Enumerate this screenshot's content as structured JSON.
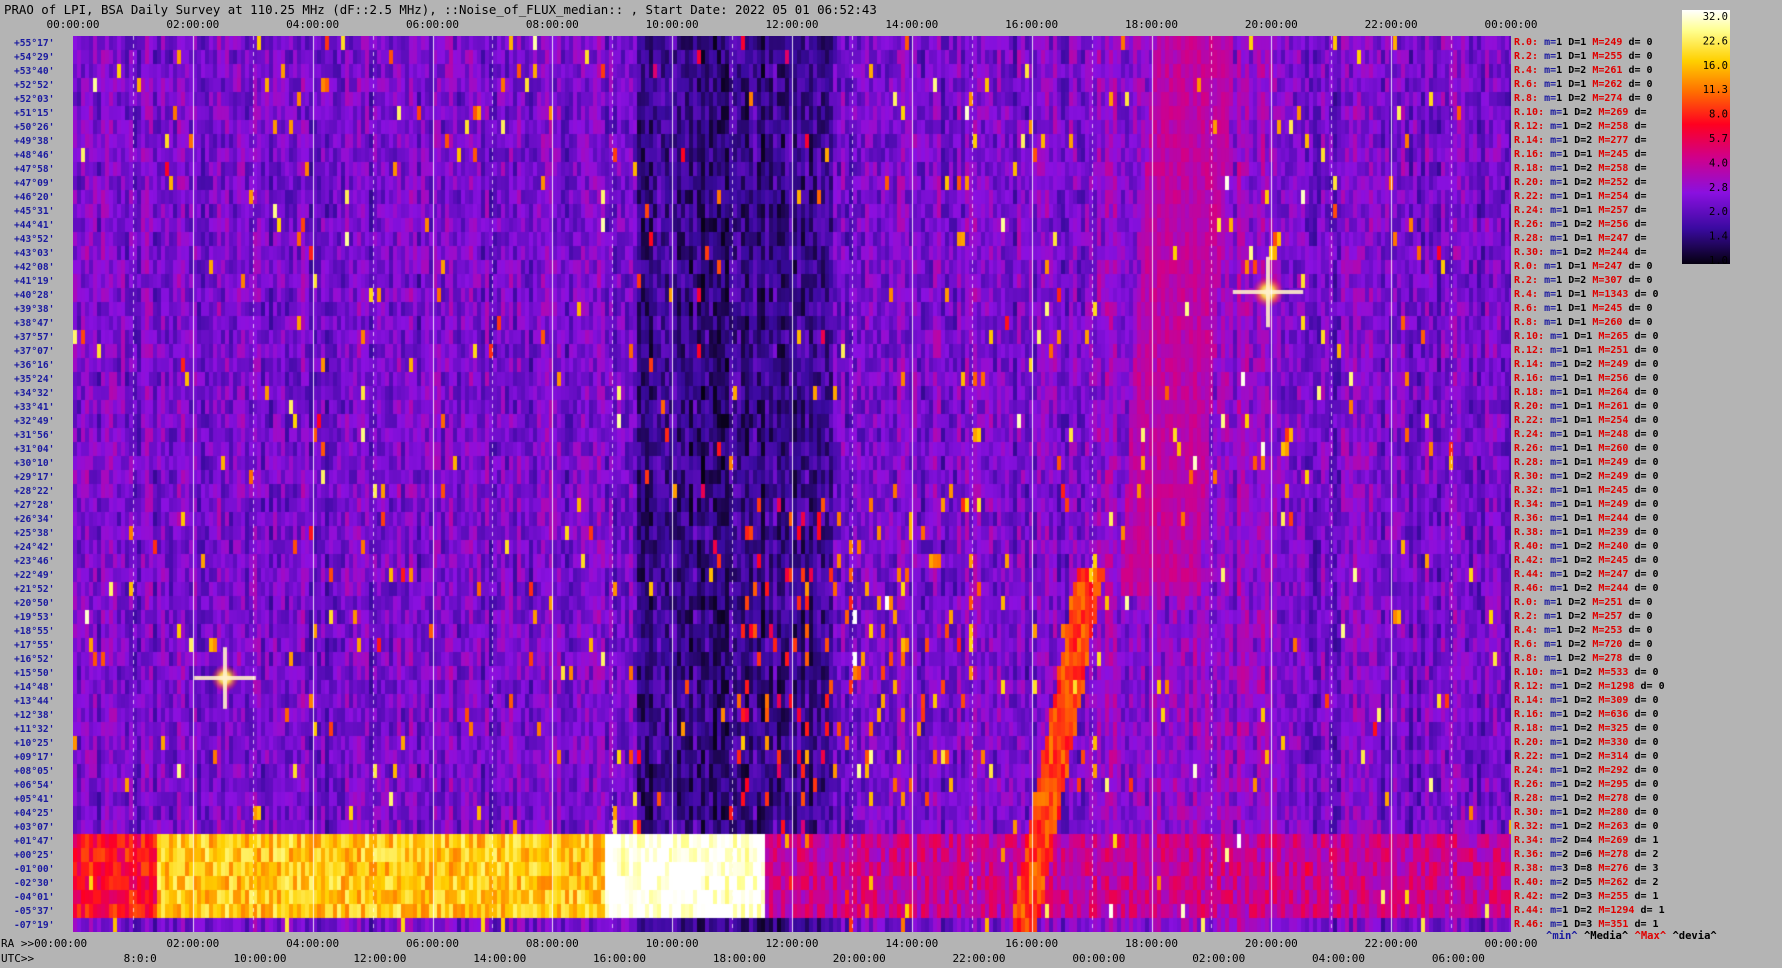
{
  "header": {
    "title": "PRAO of LPI, BSA Daily Survey at 110.25 MHz (dF::2.5 MHz), ::Noise_of_FLUX_median:: , Start Date: 2022 05 01 06:52:43"
  },
  "chart_data": {
    "type": "heatmap",
    "title": "PRAO of LPI, BSA Daily Survey at 110.25 MHz (dF::2.5 MHz), ::Noise_of_FLUX_median:: , Start Date: 2022 05 01 06:52:43",
    "top_axis_ticks": [
      "00:00:00",
      "02:00:00",
      "04:00:00",
      "06:00:00",
      "08:00:00",
      "10:00:00",
      "12:00:00",
      "14:00:00",
      "16:00:00",
      "18:00:00",
      "20:00:00",
      "22:00:00",
      "00:00:00"
    ],
    "ra_axis_label": "RA >>00:00:00",
    "ra_axis_ticks": [
      "02:00:00",
      "04:00:00",
      "06:00:00",
      "08:00:00",
      "10:00:00",
      "12:00:00",
      "14:00:00",
      "16:00:00",
      "18:00:00",
      "20:00:00",
      "22:00:00",
      "00:00:00"
    ],
    "utc_axis_label": "UTC>>",
    "utc_axis_ticks": [
      "8:0:0",
      "10:00:00",
      "12:00:00",
      "14:00:00",
      "16:00:00",
      "18:00:00",
      "20:00:00",
      "22:00:00",
      "00:00:00",
      "02:00:00",
      "04:00:00",
      "06:00:00"
    ],
    "declinations": [
      "+55°17'",
      "+54°29'",
      "+53°40'",
      "+52°52'",
      "+52°03'",
      "+51°15'",
      "+50°26'",
      "+49°38'",
      "+48°46'",
      "+47°58'",
      "+47°09'",
      "+46°20'",
      "+45°31'",
      "+44°41'",
      "+43°52'",
      "+43°03'",
      "+42°08'",
      "+41°19'",
      "+40°28'",
      "+39°38'",
      "+38°47'",
      "+37°57'",
      "+37°07'",
      "+36°16'",
      "+35°24'",
      "+34°32'",
      "+33°41'",
      "+32°49'",
      "+31°56'",
      "+31°04'",
      "+30°10'",
      "+29°17'",
      "+28°22'",
      "+27°28'",
      "+26°34'",
      "+25°38'",
      "+24°42'",
      "+23°46'",
      "+22°49'",
      "+21°52'",
      "+20°50'",
      "+19°53'",
      "+18°55'",
      "+17°55'",
      "+16°52'",
      "+15°50'",
      "+14°48'",
      "+13°44'",
      "+12°38'",
      "+11°32'",
      "+10°25'",
      "+09°17'",
      "+08°05'",
      "+06°54'",
      "+05°41'",
      "+04°25'",
      "+03°07'",
      "+01°47'",
      "+00°25'",
      "-01°00'",
      "-02°30'",
      "-04°01'",
      "-05°37'",
      "-07°19'"
    ],
    "colorbar": {
      "values": [
        "32.0",
        "22.6",
        "16.0",
        "11.3",
        "8.0",
        "5.7",
        "4.0",
        "2.8",
        "2.0",
        "1.4",
        "1.0"
      ],
      "scale": "log",
      "range": [
        1.0,
        32.0
      ]
    },
    "features": [
      {
        "kind": "point-source",
        "time": "02:42",
        "declination": "+15°50'"
      },
      {
        "kind": "point-source",
        "time": "20:00",
        "declination": "+40°28'"
      },
      {
        "kind": "bright-band",
        "declination": "-01°00'"
      }
    ]
  },
  "rows": [
    {
      "r": "R.0:",
      "m": "1",
      "D": "1",
      "M": "249",
      "d": "0"
    },
    {
      "r": "R.2:",
      "m": "1",
      "D": "1",
      "M": "255",
      "d": "0"
    },
    {
      "r": "R.4:",
      "m": "1",
      "D": "2",
      "M": "261",
      "d": "0"
    },
    {
      "r": "R.6:",
      "m": "1",
      "D": "1",
      "M": "262",
      "d": "0"
    },
    {
      "r": "R.8:",
      "m": "1",
      "D": "2",
      "M": "274",
      "d": "0"
    },
    {
      "r": "R.10:",
      "m": "1",
      "D": "2",
      "M": "269",
      "d": ""
    },
    {
      "r": "R.12:",
      "m": "1",
      "D": "2",
      "M": "258",
      "d": ""
    },
    {
      "r": "R.14:",
      "m": "1",
      "D": "2",
      "M": "277",
      "d": ""
    },
    {
      "r": "R.16:",
      "m": "1",
      "D": "1",
      "M": "245",
      "d": ""
    },
    {
      "r": "R.18:",
      "m": "1",
      "D": "2",
      "M": "258",
      "d": ""
    },
    {
      "r": "R.20:",
      "m": "1",
      "D": "2",
      "M": "252",
      "d": ""
    },
    {
      "r": "R.22:",
      "m": "1",
      "D": "1",
      "M": "254",
      "d": ""
    },
    {
      "r": "R.24:",
      "m": "1",
      "D": "1",
      "M": "257",
      "d": ""
    },
    {
      "r": "R.26:",
      "m": "1",
      "D": "2",
      "M": "256",
      "d": ""
    },
    {
      "r": "R.28:",
      "m": "1",
      "D": "1",
      "M": "247",
      "d": ""
    },
    {
      "r": "R.30:",
      "m": "1",
      "D": "2",
      "M": "244",
      "d": ""
    },
    {
      "r": "R.0:",
      "m": "1",
      "D": "1",
      "M": "247",
      "d": "0"
    },
    {
      "r": "R.2:",
      "m": "1",
      "D": "2",
      "M": "307",
      "d": "0"
    },
    {
      "r": "R.4:",
      "m": "1",
      "D": "1",
      "M": "1343",
      "d": "0"
    },
    {
      "r": "R.6:",
      "m": "1",
      "D": "1",
      "M": "245",
      "d": "0"
    },
    {
      "r": "R.8:",
      "m": "1",
      "D": "1",
      "M": "260",
      "d": "0"
    },
    {
      "r": "R.10:",
      "m": "1",
      "D": "1",
      "M": "265",
      "d": "0"
    },
    {
      "r": "R.12:",
      "m": "1",
      "D": "1",
      "M": "251",
      "d": "0"
    },
    {
      "r": "R.14:",
      "m": "1",
      "D": "2",
      "M": "249",
      "d": "0"
    },
    {
      "r": "R.16:",
      "m": "1",
      "D": "1",
      "M": "256",
      "d": "0"
    },
    {
      "r": "R.18:",
      "m": "1",
      "D": "1",
      "M": "264",
      "d": "0"
    },
    {
      "r": "R.20:",
      "m": "1",
      "D": "1",
      "M": "261",
      "d": "0"
    },
    {
      "r": "R.22:",
      "m": "1",
      "D": "1",
      "M": "254",
      "d": "0"
    },
    {
      "r": "R.24:",
      "m": "1",
      "D": "1",
      "M": "248",
      "d": "0"
    },
    {
      "r": "R.26:",
      "m": "1",
      "D": "1",
      "M": "260",
      "d": "0"
    },
    {
      "r": "R.28:",
      "m": "1",
      "D": "1",
      "M": "249",
      "d": "0"
    },
    {
      "r": "R.30:",
      "m": "1",
      "D": "2",
      "M": "249",
      "d": "0"
    },
    {
      "r": "R.32:",
      "m": "1",
      "D": "1",
      "M": "245",
      "d": "0"
    },
    {
      "r": "R.34:",
      "m": "1",
      "D": "1",
      "M": "249",
      "d": "0"
    },
    {
      "r": "R.36:",
      "m": "1",
      "D": "1",
      "M": "244",
      "d": "0"
    },
    {
      "r": "R.38:",
      "m": "1",
      "D": "1",
      "M": "239",
      "d": "0"
    },
    {
      "r": "R.40:",
      "m": "1",
      "D": "2",
      "M": "240",
      "d": "0"
    },
    {
      "r": "R.42:",
      "m": "1",
      "D": "2",
      "M": "245",
      "d": "0"
    },
    {
      "r": "R.44:",
      "m": "1",
      "D": "2",
      "M": "247",
      "d": "0"
    },
    {
      "r": "R.46:",
      "m": "1",
      "D": "2",
      "M": "244",
      "d": "0"
    },
    {
      "r": "R.0:",
      "m": "1",
      "D": "2",
      "M": "251",
      "d": "0"
    },
    {
      "r": "R.2:",
      "m": "1",
      "D": "2",
      "M": "257",
      "d": "0"
    },
    {
      "r": "R.4:",
      "m": "1",
      "D": "2",
      "M": "253",
      "d": "0"
    },
    {
      "r": "R.6:",
      "m": "1",
      "D": "2",
      "M": "720",
      "d": "0"
    },
    {
      "r": "R.8:",
      "m": "1",
      "D": "2",
      "M": "278",
      "d": "0"
    },
    {
      "r": "R.10:",
      "m": "1",
      "D": "2",
      "M": "533",
      "d": "0"
    },
    {
      "r": "R.12:",
      "m": "1",
      "D": "2",
      "M": "1298",
      "d": "0"
    },
    {
      "r": "R.14:",
      "m": "1",
      "D": "2",
      "M": "309",
      "d": "0"
    },
    {
      "r": "R.16:",
      "m": "1",
      "D": "2",
      "M": "636",
      "d": "0"
    },
    {
      "r": "R.18:",
      "m": "1",
      "D": "2",
      "M": "325",
      "d": "0"
    },
    {
      "r": "R.20:",
      "m": "1",
      "D": "2",
      "M": "330",
      "d": "0"
    },
    {
      "r": "R.22:",
      "m": "1",
      "D": "2",
      "M": "314",
      "d": "0"
    },
    {
      "r": "R.24:",
      "m": "1",
      "D": "2",
      "M": "292",
      "d": "0"
    },
    {
      "r": "R.26:",
      "m": "1",
      "D": "2",
      "M": "295",
      "d": "0"
    },
    {
      "r": "R.28:",
      "m": "1",
      "D": "2",
      "M": "278",
      "d": "0"
    },
    {
      "r": "R.30:",
      "m": "1",
      "D": "2",
      "M": "280",
      "d": "0"
    },
    {
      "r": "R.32:",
      "m": "1",
      "D": "2",
      "M": "263",
      "d": "0"
    },
    {
      "r": "R.34:",
      "m": "2",
      "D": "4",
      "M": "269",
      "d": "1"
    },
    {
      "r": "R.36:",
      "m": "2",
      "D": "6",
      "M": "278",
      "d": "2"
    },
    {
      "r": "R.38:",
      "m": "3",
      "D": "8",
      "M": "276",
      "d": "3"
    },
    {
      "r": "R.40:",
      "m": "2",
      "D": "5",
      "M": "262",
      "d": "2"
    },
    {
      "r": "R.42:",
      "m": "2",
      "D": "3",
      "M": "255",
      "d": "1"
    },
    {
      "r": "R.44:",
      "m": "1",
      "D": "2",
      "M": "1294",
      "d": "1"
    },
    {
      "r": "R.46:",
      "m": "1",
      "D": "3",
      "M": "351",
      "d": "1"
    }
  ],
  "legend_bottom": {
    "min": "^min^",
    "media": "^Media^",
    "max": "^Max^",
    "devia": "^devia^"
  },
  "colors": {
    "background": "#b4b4b4",
    "plot_bg": "#150030",
    "label_red": "#e00000",
    "label_blue": "#1a1aa0"
  }
}
